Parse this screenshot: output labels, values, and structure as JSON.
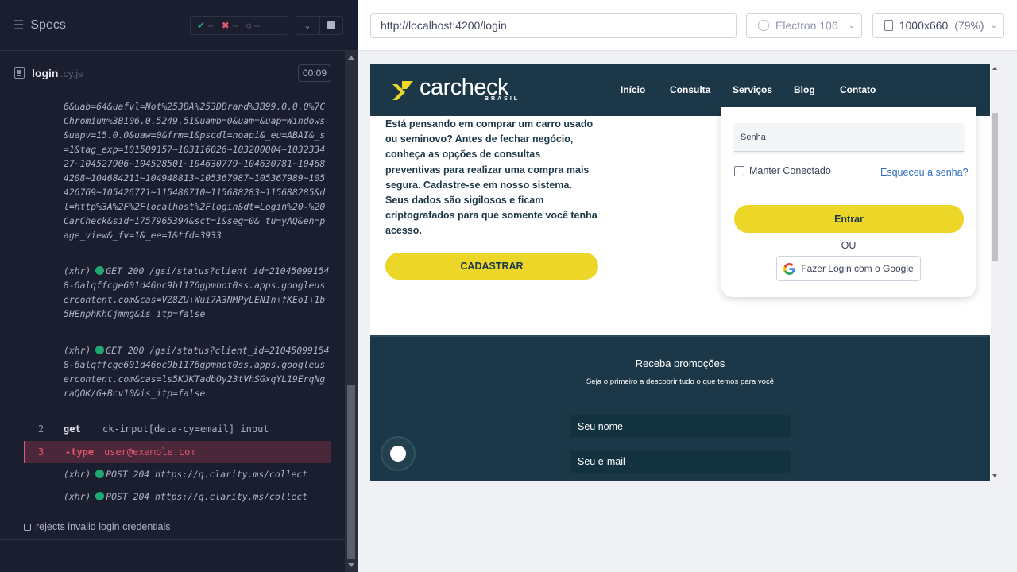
{
  "reporter": {
    "specs_label": "Specs",
    "stats": {
      "passed": "--",
      "failed": "--",
      "pending": "--"
    },
    "file": {
      "name": "login",
      "ext": ".cy.js",
      "duration": "00:09"
    },
    "url_block": "6&uab=64&uafvl=Not%253BA%253DBrand%3B99.0.0.0%7CChromium%3B106.0.5249.51&uamb=0&uam=&uap=Windows&uapv=15.0.0&uaw=0&frm=1&pscdl=noapi&_eu=ABAI&_s=1&tag_exp=101509157~103116026~103200004~103233427~104527906~104528501~104630779~104630781~104684208~104684211~104948813~105367987~105367989~105426769~105426771~115480710~115688283~115688285&dl=http%3A%2F%2Flocalhost%2Flogin&dt=Login%20-%20CarCheck&sid=1757965394&sct=1&seg=0&_tu=yAQ&en=page_view&_fv=1&_ee=1&tfd=3933",
    "xhr1": {
      "label": "(xhr)",
      "text": "GET 200 /gsi/status?client_id=210450991548-6alqffcge601d46pc9b1176gpmhot0ss.apps.googleusercontent.com&cas=VZ8ZU+Wui7A3NMPyLENIn+fKEoI+1b5HEnphKhCjmmg&is_itp=false"
    },
    "xhr2": {
      "label": "(xhr)",
      "text": "GET 200 /gsi/status?client_id=210450991548-6alqffcge601d46pc9b1176gpmhot0ss.apps.googleusercontent.com&cas=ls5KJKTadbOy23tVhSGxqYL19ErqNgraQOK/G+Bcv10&is_itp=false"
    },
    "commands": [
      {
        "num": "2",
        "name": "get",
        "msg": "ck-input[data-cy=email] input"
      },
      {
        "num": "3",
        "name": "-type",
        "msg": "user@example.com"
      }
    ],
    "xhr3": {
      "label": "(xhr)",
      "text": "POST 204 https://q.clarity.ms/collect"
    },
    "xhr4": {
      "label": "(xhr)",
      "text": "POST 204 https://q.clarity.ms/collect"
    },
    "test_title": "rejects invalid login credentials"
  },
  "aut": {
    "url": "http://localhost:4200/login",
    "browser": "Electron 106",
    "viewport": "1000x660",
    "scale": "(79%)"
  },
  "site": {
    "logo": {
      "name": "carcheck",
      "sub": "BRASIL"
    },
    "nav": [
      "Início",
      "Consulta",
      "Serviços",
      "Blog",
      "Contato"
    ],
    "intro": "Está pensando em comprar um carro usado ou seminovo? Antes de fechar negócio, conheça as opções de consultas preventivas para realizar uma compra mais segura. Cadastre-se em nosso sistema. Seus dados são sigilosos e ficam criptografados para que somente você tenha acesso.",
    "register_button": "CADASTRAR",
    "login": {
      "password_placeholder": "Senha",
      "keep_connected": "Manter Conectado",
      "forgot": "Esqueceu a senha?",
      "enter_button": "Entrar",
      "or": "OU",
      "google_button": "Fazer Login com o Google"
    },
    "promo": {
      "title": "Receba promoções",
      "subtitle": "Seja o primeiro a descobrir tudo o que temos para você",
      "name_placeholder": "Seu nome",
      "email_placeholder": "Seu e-mail"
    }
  }
}
